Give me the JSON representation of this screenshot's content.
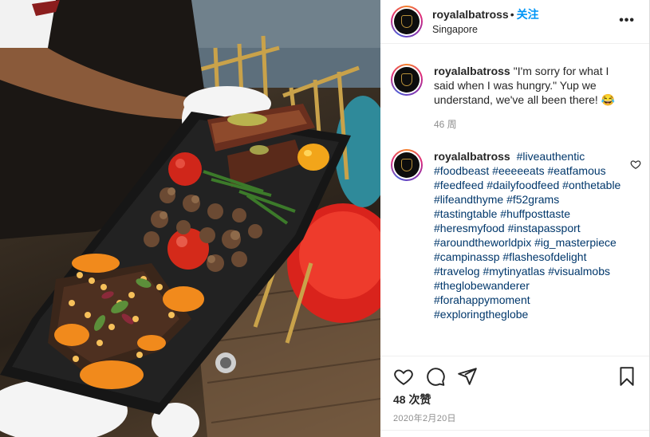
{
  "post": {
    "username": "royalalbatross",
    "separator": "•",
    "follow_label": "关注",
    "location": "Singapore",
    "more_label": "•••"
  },
  "comments": [
    {
      "username": "royalalbatross",
      "text": "\"I'm sorry for what I said when I was hungry.\" Yup we understand, we've all been there! 😂",
      "time": "46 周"
    },
    {
      "username": "royalalbatross",
      "hashtags": [
        "#liveauthentic",
        "#foodbeast",
        "#eeeeeats",
        "#eatfamous",
        "#feedfeed",
        "#dailyfoodfeed",
        "#onthetable",
        "#lifeandthyme",
        "#f52grams",
        "#tastingtable",
        "#huffposttaste",
        "#heresmyfood",
        "#instapassport",
        "#aroundtheworldpix",
        "#ig_masterpiece",
        "#campinassp",
        "#flashesofdelight",
        "#travelog",
        "#mytinyatlas",
        "#visualmobs",
        "#theglobewanderer",
        "#forahappymoment",
        "#exploringtheglobe"
      ]
    }
  ],
  "actions": {
    "like_icon": "heart-icon",
    "comment_icon": "comment-icon",
    "share_icon": "share-icon",
    "save_icon": "bookmark-icon",
    "likes": "48 次赞",
    "date": "2020年2月20日"
  },
  "colors": {
    "accent": "#0095f6",
    "hashtag": "#00376b",
    "muted": "#8e8e8e"
  }
}
